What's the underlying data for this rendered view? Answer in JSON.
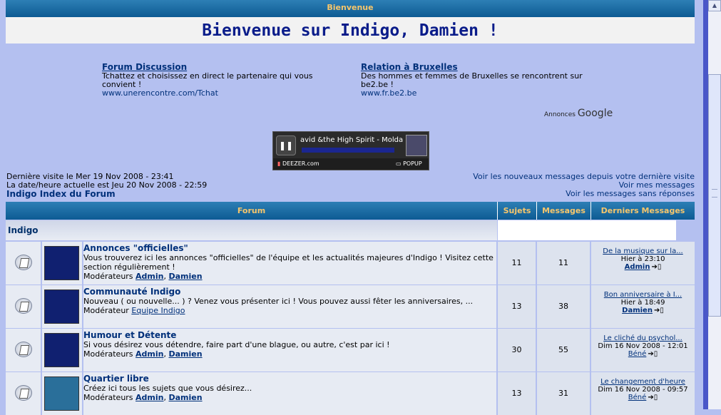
{
  "header": {
    "bar_label": "Bienvenue",
    "title": "Bienvenue sur Indigo, Damien !"
  },
  "ads": [
    {
      "title": "Forum Discussion",
      "text": "Tchattez et choisissez en direct le partenaire qui vous convient !",
      "url": "www.unerencontre.com/Tchat"
    },
    {
      "title": "Relation à Bruxelles",
      "text": "Des hommes et femmes de Bruxelles se rencontrent sur be2.be !",
      "url": "www.fr.be2.be"
    }
  ],
  "ads_label": "Annonces",
  "ads_brand": "Google",
  "player": {
    "track": "avid &the High Spirit - Moldau",
    "brand": "DEEZER.com",
    "popup": "POPUP"
  },
  "info": {
    "last_visit": "Dernière visite le Mer 19 Nov 2008 - 23:41",
    "now": "La date/heure actuelle est Jeu 20 Nov 2008 - 22:59",
    "index_link": "Indigo Index du Forum",
    "links": [
      "Voir les nouveaux messages depuis votre dernière visite",
      "Voir mes messages",
      "Voir les messages sans réponses"
    ]
  },
  "table": {
    "headers": [
      "Forum",
      "Sujets",
      "Messages",
      "Derniers Messages"
    ],
    "category": "Indigo",
    "rows": [
      {
        "name": "Annonces \"officielles\"",
        "desc": "Vous trouverez ici les annonces \"officielles\" de l'équipe et les actualités majeures d'Indigo ! Visitez cette section régulièrement !",
        "mod_label": "Modérateurs",
        "mods": [
          "Admin",
          "Damien"
        ],
        "topics": "11",
        "posts": "11",
        "last_title": "De la musique sur la...",
        "last_date": "Hier à 23:10",
        "last_user": "Admin"
      },
      {
        "name": "Communauté Indigo",
        "desc": "Nouveau ( ou nouvelle... ) ? Venez vous présenter ici ! Vous pouvez aussi fêter les anniversaires, ...",
        "mod_label": "Modérateur",
        "mods": [
          "Equipe Indigo"
        ],
        "topics": "13",
        "posts": "38",
        "last_title": "Bon anniversaire à I...",
        "last_date": "Hier à 18:49",
        "last_user": "Damien"
      },
      {
        "name": "Humour et Détente",
        "desc": "Si vous désirez vous détendre, faire part d'une blague, ou autre, c'est par ici !",
        "mod_label": "Modérateurs",
        "mods": [
          "Admin",
          "Damien"
        ],
        "topics": "30",
        "posts": "55",
        "last_title": "Le cliché du psychol...",
        "last_date": "Dim 16 Nov 2008 - 12:01",
        "last_user": "Béné"
      },
      {
        "name": "Quartier libre",
        "desc": "Créez ici tous les sujets que vous désirez...",
        "mod_label": "Modérateurs",
        "mods": [
          "Admin",
          "Damien"
        ],
        "topics": "13",
        "posts": "31",
        "last_title": "Le changement d'heure",
        "last_date": "Dim 16 Nov 2008 - 09:57",
        "last_user": "Béné"
      }
    ]
  },
  "colors": {
    "header_gradient_top": "#2d7fb5",
    "header_text": "#f7c66b",
    "page_bg": "#b4c0f0",
    "link": "#00307a"
  }
}
